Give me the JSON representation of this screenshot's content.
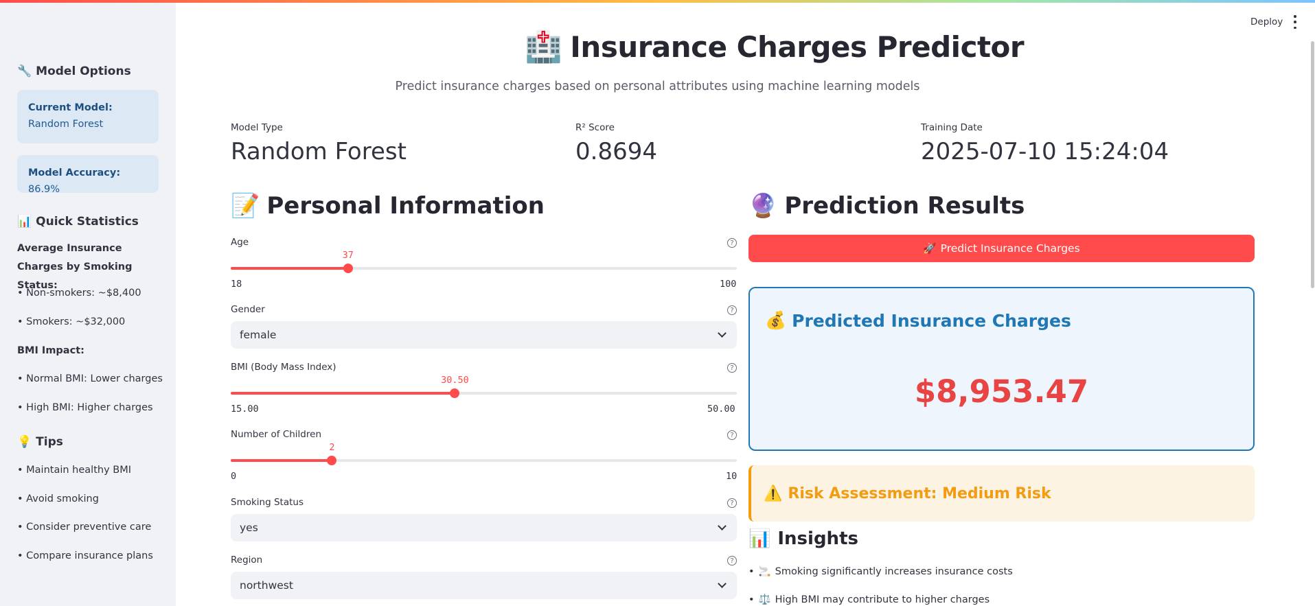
{
  "app": {
    "deploy_label": "Deploy",
    "title": "Insurance Charges Predictor",
    "subtitle": "Predict insurance charges based on personal attributes using machine learning models"
  },
  "sidebar": {
    "model_options_heading": "Model Options",
    "current_model_label": "Current Model:",
    "current_model_value": "Random Forest",
    "accuracy_label": "Model Accuracy:",
    "accuracy_value": "86.9%",
    "quick_stats_heading": "Quick Statistics",
    "avg_heading": "Average Insurance Charges by Smoking Status:",
    "non_smokers": "• Non-smokers: ~$8,400",
    "smokers": "• Smokers: ~$32,000",
    "bmi_heading": "BMI Impact:",
    "bmi_normal": "• Normal BMI: Lower charges",
    "bmi_high": "• High BMI: Higher charges",
    "tips_heading": "Tips",
    "tips": [
      "• Maintain healthy BMI",
      "• Avoid smoking",
      "• Consider preventive care",
      "• Compare insurance plans"
    ]
  },
  "metrics": [
    {
      "label": "Model Type",
      "value": "Random Forest"
    },
    {
      "label": "R² Score",
      "value": "0.8694"
    },
    {
      "label": "Training Date",
      "value": "2025-07-10 15:24:04"
    }
  ],
  "form": {
    "heading": "Personal Information",
    "age": {
      "label": "Age",
      "value": "37",
      "min": "18",
      "max": "100",
      "fraction": 0.2317
    },
    "gender": {
      "label": "Gender",
      "value": "female"
    },
    "bmi": {
      "label": "BMI (Body Mass Index)",
      "value": "30.50",
      "min": "15.00",
      "max": "50.00",
      "fraction": 0.4429
    },
    "children": {
      "label": "Number of Children",
      "value": "2",
      "min": "0",
      "max": "10",
      "fraction": 0.2
    },
    "smoking": {
      "label": "Smoking Status",
      "value": "yes"
    },
    "region": {
      "label": "Region",
      "value": "northwest"
    }
  },
  "results": {
    "heading": "Prediction Results",
    "predict_button": "Predict Insurance Charges",
    "predicted_heading": "Predicted Insurance Charges",
    "predicted_amount": "$8,953.47",
    "risk": "Risk Assessment: Medium Risk",
    "insights_heading": "Insights",
    "insights": [
      "Smoking significantly increases insurance costs",
      "High BMI may contribute to higher charges"
    ]
  },
  "colors": {
    "accent": "#ff4b4b",
    "info": "#1f77b4",
    "warning": "#f39c12"
  }
}
